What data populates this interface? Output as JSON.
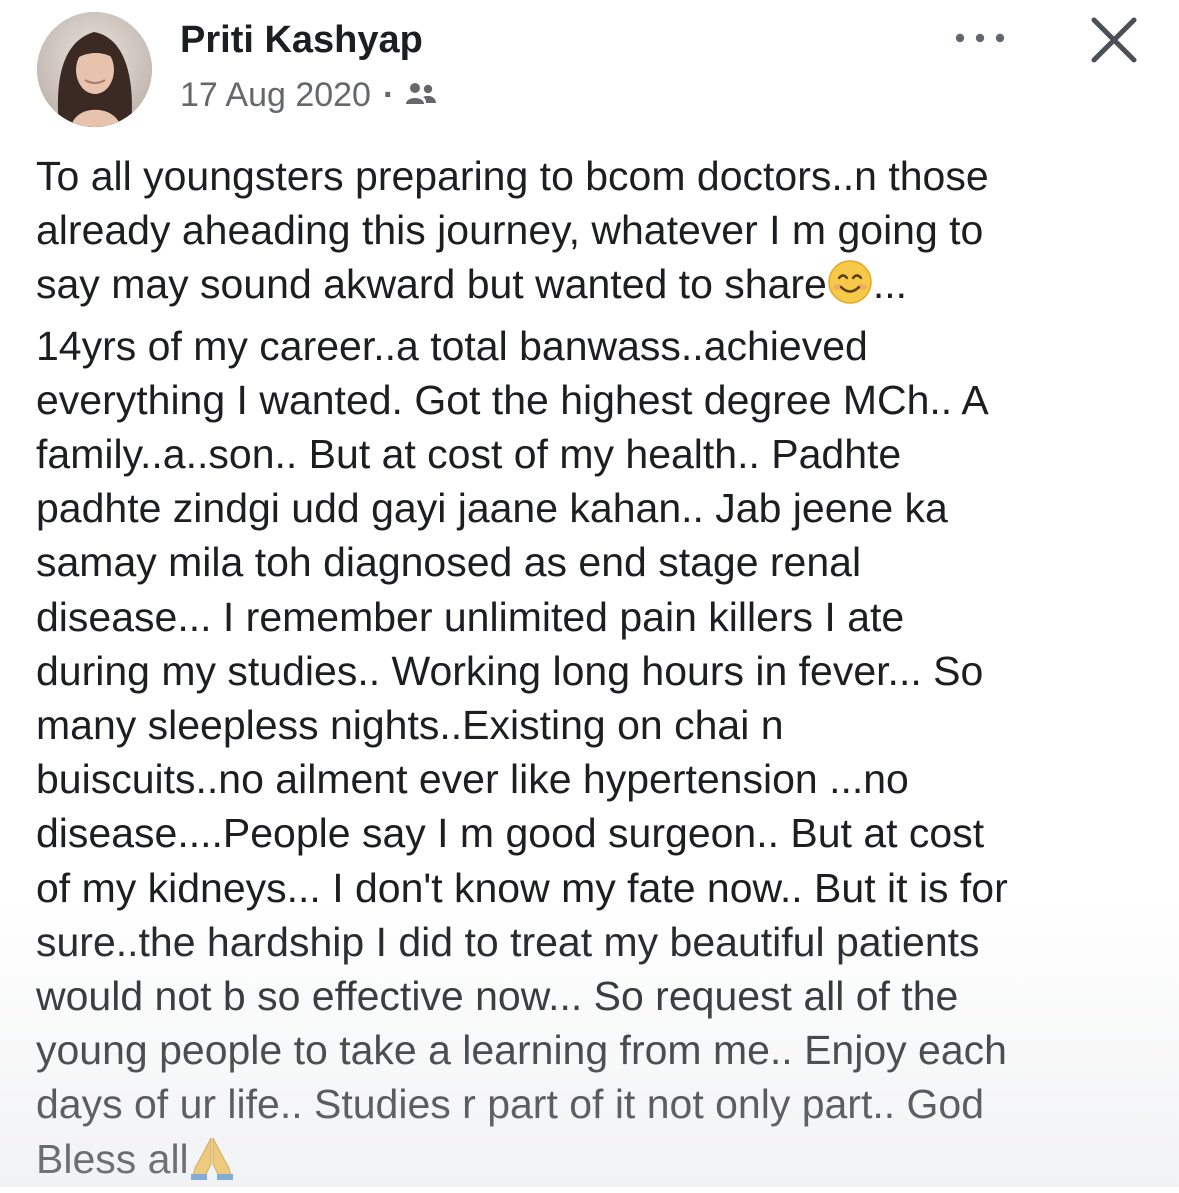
{
  "post": {
    "author_name": "Priti Kashyap",
    "date": "17 Aug 2020",
    "separator": "·",
    "audience_icon": "friends-icon",
    "more_icon": "more-options-icon",
    "close_icon": "close-icon",
    "body_lines": [
      "To all youngsters preparing to bcom doctors..n those",
      "already aheading this journey, whatever I m going to",
      "say may sound akward but wanted to share",
      "...",
      "14yrs of my career..a total banwass..achieved",
      "everything I wanted. Got the highest degree MCh.. A",
      "family..a..son.. But at cost of my health.. Padhte",
      "padhte zindgi udd gayi jaane kahan.. Jab jeene ka",
      "samay mila toh diagnosed as end stage renal",
      "disease... I remember unlimited pain killers I ate",
      "during my studies.. Working long hours in fever... So",
      "many sleepless nights..Existing on chai n",
      "buiscuits..no ailment ever like hypertension ...no",
      "disease....People say I m good surgeon.. But at cost",
      "of my kidneys... I don't know my fate now.. But it is for",
      "sure..the hardship I did to treat my beautiful patients",
      "would not b so effective now... So request all of the",
      "young people to take a learning from me.. Enjoy each",
      "days of ur life.. Studies r part of it not only part.. God",
      "Bless all"
    ],
    "emojis": [
      "smiling-face-emoji",
      "folded-hands-emoji"
    ]
  }
}
